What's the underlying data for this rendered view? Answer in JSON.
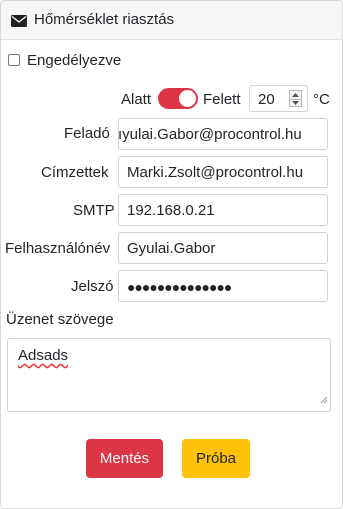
{
  "header": {
    "title": "Hőmérséklet riasztás",
    "icon": "envelope-icon"
  },
  "enabled": {
    "label": "Engedélyezve",
    "checked": false
  },
  "threshold": {
    "below_label": "Alatt",
    "above_label": "Felett",
    "toggle_on": true,
    "value": "20",
    "unit": "°C"
  },
  "fields": {
    "sender": {
      "label": "Feladó",
      "value": "ıyulai.Gabor@procontrol.hu"
    },
    "recipients": {
      "label": "Címzettek",
      "value": "Marki.Zsolt@procontrol.hu"
    },
    "smtp": {
      "label": "SMTP",
      "value": "192.168.0.21"
    },
    "username": {
      "label": "Felhasználónév",
      "value": "Gyulai.Gabor"
    },
    "password": {
      "label": "Jelszó",
      "value": "●●●●●●●●●●●●●●"
    }
  },
  "message": {
    "label": "Üzenet szövege",
    "value": "Adsads"
  },
  "buttons": {
    "save": "Mentés",
    "test": "Próba"
  },
  "colors": {
    "danger": "#dc3545",
    "warning": "#ffc107",
    "border": "#ced4da"
  }
}
